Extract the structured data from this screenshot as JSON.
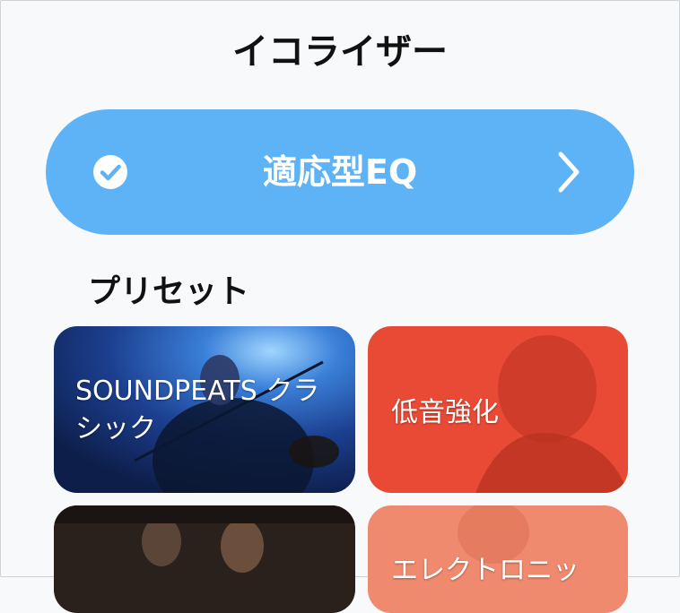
{
  "header": {
    "title": "イコライザー"
  },
  "adaptive_eq": {
    "label": "適応型EQ",
    "check_icon": "check-circle-icon",
    "chevron_icon": "chevron-right-icon",
    "color": "#5eb3f6"
  },
  "presets": {
    "heading": "プリセット",
    "cards": [
      {
        "label": "SOUNDPEATS クラシック",
        "color": "#1f4aa3"
      },
      {
        "label": "低音強化",
        "color": "#e84a35"
      },
      {
        "label": "",
        "color": "#2a211d"
      },
      {
        "label": "エレクトロニッ",
        "color": "#ef8a6e"
      }
    ]
  }
}
